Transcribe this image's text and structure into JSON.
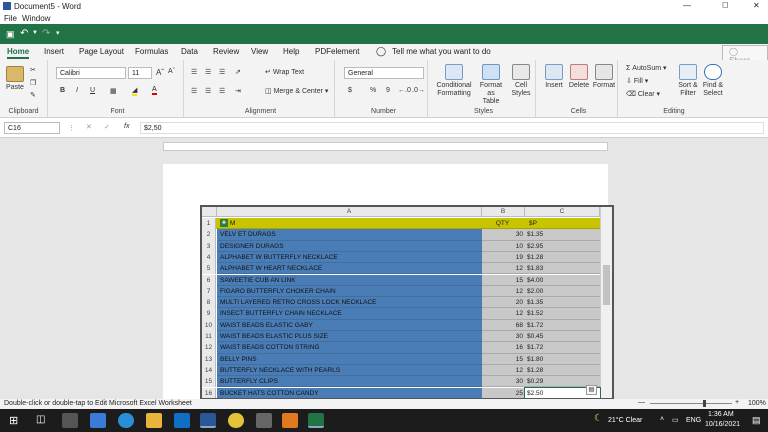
{
  "window": {
    "title": "Document5 - Word"
  },
  "menubar": {
    "file": "File",
    "window": "Window"
  },
  "tabs": [
    {
      "label": "Home"
    },
    {
      "label": "Insert"
    },
    {
      "label": "Page Layout"
    },
    {
      "label": "Formulas"
    },
    {
      "label": "Data"
    },
    {
      "label": "Review"
    },
    {
      "label": "View"
    },
    {
      "label": "Help"
    },
    {
      "label": "PDFelement"
    }
  ],
  "tell_me": "Tell me what you want to do",
  "share": "Share",
  "ribbon": {
    "clipboard": {
      "label": "Clipboard",
      "paste": "Paste"
    },
    "font": {
      "label": "Font",
      "name": "Calibri",
      "size": "11",
      "bold": "B",
      "italic": "I",
      "underline": "U"
    },
    "alignment": {
      "label": "Alignment",
      "wrap": "Wrap Text",
      "merge": "Merge & Center"
    },
    "number": {
      "label": "Number",
      "format": "General",
      "currency": "$",
      "percent": "%",
      "comma": "9"
    },
    "styles": {
      "label": "Styles",
      "conditional": "Conditional",
      "conditional2": "Formatting",
      "table": "Format as",
      "table2": "Table",
      "cell": "Cell",
      "cell2": "Styles"
    },
    "cells": {
      "label": "Cells",
      "insert": "Insert",
      "delete": "Delete",
      "format": "Format"
    },
    "editing": {
      "label": "Editing",
      "autosum": "AutoSum",
      "fill": "Fill",
      "clear": "Clear",
      "sort": "Sort &",
      "sort2": "Filter",
      "find": "Find &",
      "find2": "Select"
    }
  },
  "formula": {
    "cellref": "C16",
    "fx": "fx",
    "value": "$2,50"
  },
  "sheet": {
    "columns": [
      "A",
      "B",
      "C"
    ],
    "header": {
      "a": "M",
      "b": "QTY",
      "c": "$P"
    },
    "rows": [
      {
        "n": "2",
        "a": "VELV ET DURAGS",
        "b": "30",
        "c": "$1.35"
      },
      {
        "n": "3",
        "a": "DESIGNER DURAGS",
        "b": "10",
        "c": "$2.95"
      },
      {
        "n": "4",
        "a": "ALPHABET W BUTTERFLY NECKLACE",
        "b": "19",
        "c": "$1.28"
      },
      {
        "n": "5",
        "a": "ALPHABET W HEART NECKLACE",
        "b": "12",
        "c": "$1.83"
      },
      {
        "n": "6",
        "a": "SAWEETIE CUB AN LINK",
        "b": "15",
        "c": "$4.00"
      },
      {
        "n": "7",
        "a": "FIGARO BUTTERFLY CHOKER CHAIN",
        "b": "12",
        "c": "$2.00"
      },
      {
        "n": "8",
        "a": "MULTI LAYERED RETRO CROSS LOCK NECKLACE",
        "b": "20",
        "c": "$1.35"
      },
      {
        "n": "9",
        "a": "INSECT BUTTERFLY CHAIN NECKLACE",
        "b": "12",
        "c": "$1.52"
      },
      {
        "n": "10",
        "a": "WAIST BEADS ELASTIC GABY",
        "b": "68",
        "c": "$1.72"
      },
      {
        "n": "11",
        "a": "WAIST BEADS ELASTIC PLUS SIZE",
        "b": "30",
        "c": "$0.45"
      },
      {
        "n": "12",
        "a": "WAIST BEADS COTTON STRING",
        "b": "16",
        "c": "$1.72"
      },
      {
        "n": "13",
        "a": "BELLY PINS",
        "b": "15",
        "c": "$1.80"
      },
      {
        "n": "14",
        "a": "BUTTERFLY NECKLACE WITH PEARLS",
        "b": "12",
        "c": "$1.28"
      },
      {
        "n": "15",
        "a": "BUTTERFLY CLIPS",
        "b": "30",
        "c": "$0.29"
      },
      {
        "n": "16",
        "a": "BUCKET HATS COTTON CANDY",
        "b": "25",
        "c": "$2.50"
      }
    ]
  },
  "status": {
    "text": "Double-click or double-tap to Edit Microsoft Excel Worksheet",
    "zoom": "100%"
  },
  "taskbar": {
    "weather": "21°C  Clear",
    "lang": "ENG",
    "time": "1:36 AM",
    "date": "10/16/2021"
  },
  "colors": {
    "excel_green": "#217346",
    "selection_blue": "#4a7db6",
    "header_yellow": "#c8c400"
  }
}
